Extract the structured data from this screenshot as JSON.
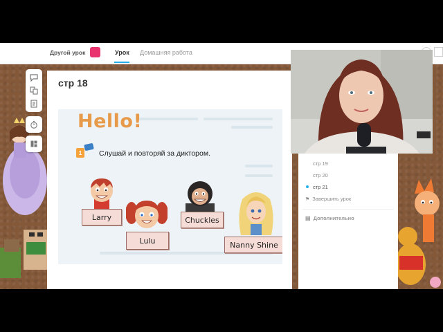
{
  "header": {
    "other_lesson": "Другой урок",
    "tabs": [
      {
        "label": "Урок",
        "active": true
      },
      {
        "label": "Домашняя работа",
        "active": false
      }
    ]
  },
  "tools": [
    {
      "icon": "chat-icon"
    },
    {
      "icon": "translate-icon"
    },
    {
      "icon": "notes-icon"
    },
    {
      "icon": "timer-icon"
    },
    {
      "icon": "layout-icon"
    }
  ],
  "card": {
    "title": "стр 18",
    "page": {
      "heading": "Hello!",
      "instruction": "Слушай и повторяй за диктором.",
      "characters": [
        "Larry",
        "Lulu",
        "Chuckles",
        "Nanny Shine"
      ]
    }
  },
  "page_nav": {
    "items": [
      {
        "label": "стр 19",
        "current": false
      },
      {
        "label": "стр 20",
        "current": false
      },
      {
        "label": "стр 21",
        "current": true
      }
    ],
    "finish_label": "Завершить урок",
    "extra_label": "Дополнительно"
  },
  "colors": {
    "accent": "#27b0e6",
    "brand_pink": "#e8336f",
    "heading_orange": "#e79a4a",
    "board_brown": "#84593a"
  }
}
